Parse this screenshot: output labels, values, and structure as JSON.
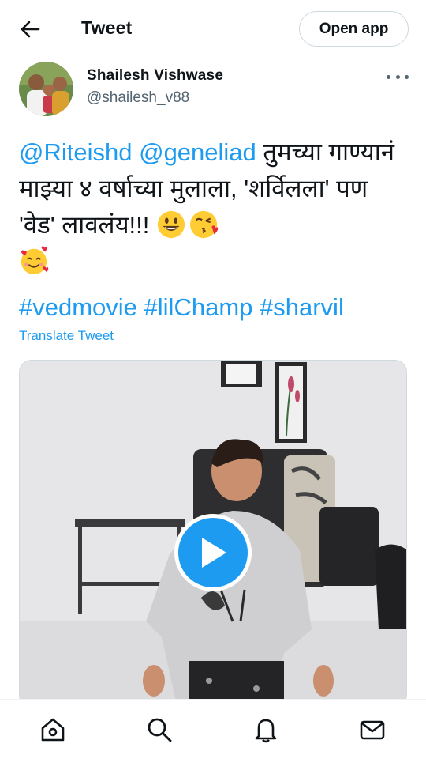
{
  "header": {
    "title": "Tweet",
    "back_icon": "arrow-left-icon",
    "open_app_label": "Open app"
  },
  "author": {
    "name": "Shailesh Vishwase",
    "handle": "@shailesh_v88",
    "more_icon": "more-horizontal-icon"
  },
  "tweet": {
    "mention1": "@Riteishd",
    "mention2": "@geneliad",
    "text_line1": " तुमच्या गाण्यानं माझ्या ४ वर्षाच्या मुलाला, 'शर्विलला' पण 'वेड' लावलंय!!! ",
    "emojis": [
      "grinning-face-emoji",
      "face-blowing-kiss-emoji",
      "smiling-face-with-hearts-emoji"
    ],
    "hashtags": [
      "#vedmovie",
      "#lilChamp",
      "#sharvil"
    ],
    "translate_label": "Translate Tweet"
  },
  "media": {
    "type": "video",
    "play_icon": "play-icon"
  },
  "bottom_nav": {
    "items": [
      "home-icon",
      "search-icon",
      "notifications-bell-icon",
      "messages-envelope-icon"
    ]
  },
  "colors": {
    "accent": "#1d9bf0",
    "text": "#0f1419",
    "secondary": "#536471"
  }
}
